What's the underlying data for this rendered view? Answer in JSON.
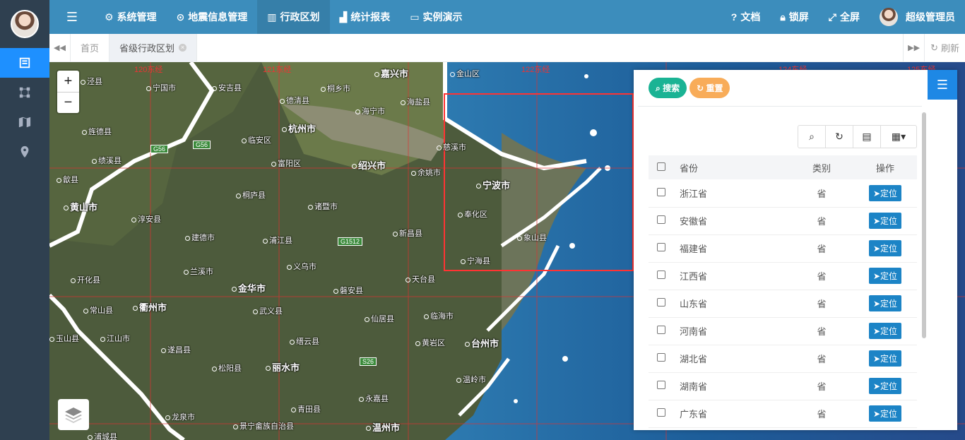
{
  "nav": {
    "items": [
      {
        "label": "系统管理",
        "icon": "gear-icon"
      },
      {
        "label": "地震信息管理",
        "icon": "map-marker-icon"
      },
      {
        "label": "行政区划",
        "icon": "bank-icon"
      },
      {
        "label": "统计报表",
        "icon": "chart-icon"
      },
      {
        "label": "实例演示",
        "icon": "monitor-icon"
      }
    ],
    "right": [
      {
        "label": "文档",
        "icon": "question-icon"
      },
      {
        "label": "锁屏",
        "icon": "lock-icon"
      },
      {
        "label": "全屏",
        "icon": "fullscreen-icon"
      }
    ],
    "username": "超级管理员"
  },
  "tabs": {
    "home": "首页",
    "current": "省级行政区划",
    "refresh": "刷新"
  },
  "map": {
    "cities": [
      {
        "label": "嘉兴市"
      },
      {
        "label": "金山区"
      },
      {
        "label": "宁国市"
      },
      {
        "label": "安吉县"
      },
      {
        "label": "德清县"
      },
      {
        "label": "桐乡市"
      },
      {
        "label": "海盐县"
      },
      {
        "label": "海宁市"
      },
      {
        "label": "杭州市"
      },
      {
        "label": "临安区"
      },
      {
        "label": "旌德县"
      },
      {
        "label": "绩溪县"
      },
      {
        "label": "慈溪市"
      },
      {
        "label": "绍兴市"
      },
      {
        "label": "余姚市"
      },
      {
        "label": "富阳区"
      },
      {
        "label": "宁波市"
      },
      {
        "label": "桐庐县"
      },
      {
        "label": "诸暨市"
      },
      {
        "label": "黄山市"
      },
      {
        "label": "淳安县"
      },
      {
        "label": "建德市"
      },
      {
        "label": "浦江县"
      },
      {
        "label": "新昌县"
      },
      {
        "label": "奉化区"
      },
      {
        "label": "象山县"
      },
      {
        "label": "义乌市"
      },
      {
        "label": "兰溪市"
      },
      {
        "label": "宁海县"
      },
      {
        "label": "开化县"
      },
      {
        "label": "金华市"
      },
      {
        "label": "天台县"
      },
      {
        "label": "磐安县"
      },
      {
        "label": "常山县"
      },
      {
        "label": "衢州市"
      },
      {
        "label": "武义县"
      },
      {
        "label": "仙居县"
      },
      {
        "label": "临海市"
      },
      {
        "label": "江山市"
      },
      {
        "label": "缙云县"
      },
      {
        "label": "黄岩区"
      },
      {
        "label": "台州市"
      },
      {
        "label": "遂昌县"
      },
      {
        "label": "松阳县"
      },
      {
        "label": "丽水市"
      },
      {
        "label": "温岭市"
      },
      {
        "label": "永嘉县"
      },
      {
        "label": "龙泉市"
      },
      {
        "label": "青田县"
      },
      {
        "label": "景宁畲族自治县"
      },
      {
        "label": "温州市"
      },
      {
        "label": "浦城县"
      },
      {
        "label": "玉山县"
      },
      {
        "label": "歙县"
      },
      {
        "label": "泾县"
      }
    ],
    "roads": [
      "G56",
      "G56",
      "G1512",
      "S26"
    ],
    "coord_labels": [
      "120东经",
      "121东经",
      "122东经",
      "123东经",
      "124东经",
      "125东经"
    ]
  },
  "panel": {
    "search_label": "搜索",
    "reset_label": "重置",
    "columns": [
      "省份",
      "类别",
      "操作"
    ],
    "locate_label": "定位",
    "rows": [
      {
        "province": "浙江省",
        "type": "省"
      },
      {
        "province": "安徽省",
        "type": "省"
      },
      {
        "province": "福建省",
        "type": "省"
      },
      {
        "province": "江西省",
        "type": "省"
      },
      {
        "province": "山东省",
        "type": "省"
      },
      {
        "province": "河南省",
        "type": "省"
      },
      {
        "province": "湖北省",
        "type": "省"
      },
      {
        "province": "湖南省",
        "type": "省"
      },
      {
        "province": "广东省",
        "type": "省"
      }
    ]
  }
}
